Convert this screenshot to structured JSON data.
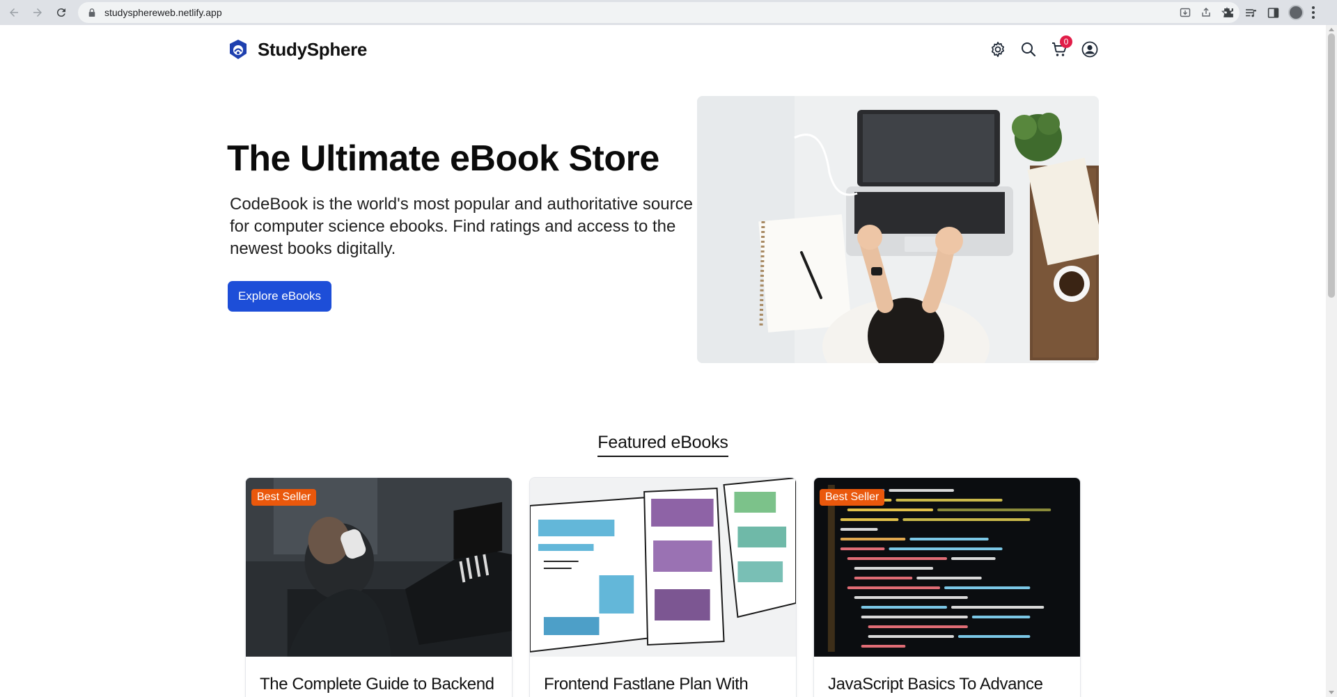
{
  "browser": {
    "url": "studysphereweb.netlify.app"
  },
  "header": {
    "brand": "StudySphere",
    "cart_count": "0"
  },
  "hero": {
    "title": "The Ultimate eBook Store",
    "description": "CodeBook is the world's most popular and authoritative source for computer science ebooks. Find ratings and access to the newest books digitally.",
    "button_label": "Explore eBooks"
  },
  "featured": {
    "heading": "Featured eBooks",
    "cards": [
      {
        "badge": "Best Seller",
        "title": "The Complete Guide to Backend Development"
      },
      {
        "badge": "",
        "title": "Frontend Fastlane Plan With Projects"
      },
      {
        "badge": "Best Seller",
        "title": "JavaScript Basics To Advance With Challenges"
      }
    ]
  },
  "colors": {
    "accent": "#1d4ed8",
    "badge": "#ea580c",
    "cart_badge": "#e11d48",
    "logo": "#1e40af"
  }
}
